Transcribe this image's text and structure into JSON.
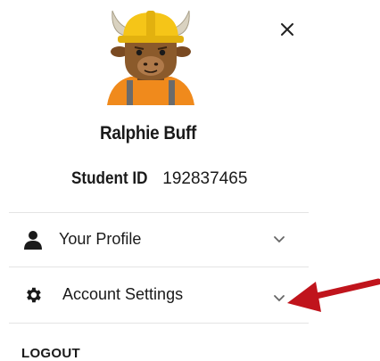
{
  "user": {
    "name": "Ralphie Buff",
    "student_id_label": "Student ID",
    "student_id_value": "192837465"
  },
  "menu": {
    "items": [
      {
        "label": "Your Profile",
        "icon": "person-icon"
      },
      {
        "label": "Account Settings",
        "icon": "gear-icon"
      }
    ],
    "logout_label": "LOGOUT"
  },
  "icons": {
    "close": "close-icon",
    "chevron": "chevron-down-icon",
    "annotation": "red-arrow-annotation"
  },
  "colors": {
    "annotation_arrow": "#c0141c",
    "helmet": "#f5c518",
    "shirt": "#f08a1c",
    "bison_fur": "#8b5a2b",
    "divider": "#e4e4e4"
  }
}
